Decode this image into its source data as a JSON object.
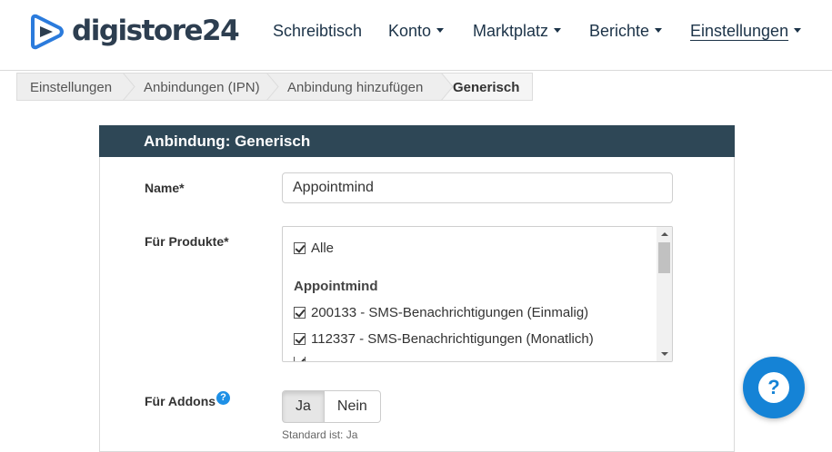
{
  "brand": {
    "name": "digistore24",
    "accent": "#1c3348",
    "logo_blue": "#2b7bdc"
  },
  "nav": {
    "items": [
      {
        "label": "Schreibtisch",
        "dropdown": false,
        "active": false
      },
      {
        "label": "Konto",
        "dropdown": true,
        "active": false
      },
      {
        "label": "Marktplatz",
        "dropdown": true,
        "active": false
      },
      {
        "label": "Berichte",
        "dropdown": true,
        "active": false
      },
      {
        "label": "Einstellungen",
        "dropdown": true,
        "active": true
      }
    ]
  },
  "breadcrumb": [
    "Einstellungen",
    "Anbindungen (IPN)",
    "Anbindung hinzufügen",
    "Generisch"
  ],
  "panel": {
    "title": "Anbindung: Generisch",
    "header_color": "#2e4756",
    "name_label": "Name*",
    "name_value": "Appointmind",
    "products_label": "Für Produkte*",
    "products": {
      "all_label": "Alle",
      "group_label": "Appointmind",
      "items": [
        "200133 - SMS-Benachrichtigungen (Einmalig)",
        "112337 - SMS-Benachrichtigungen (Monatlich)"
      ]
    },
    "addons_label": "Für Addons",
    "addons_toggle": {
      "yes": "Ja",
      "no": "Nein",
      "selected": "Ja"
    },
    "addons_hint": "Standard ist: Ja"
  },
  "help_button": {
    "symbol": "?",
    "color": "#1583d6"
  }
}
